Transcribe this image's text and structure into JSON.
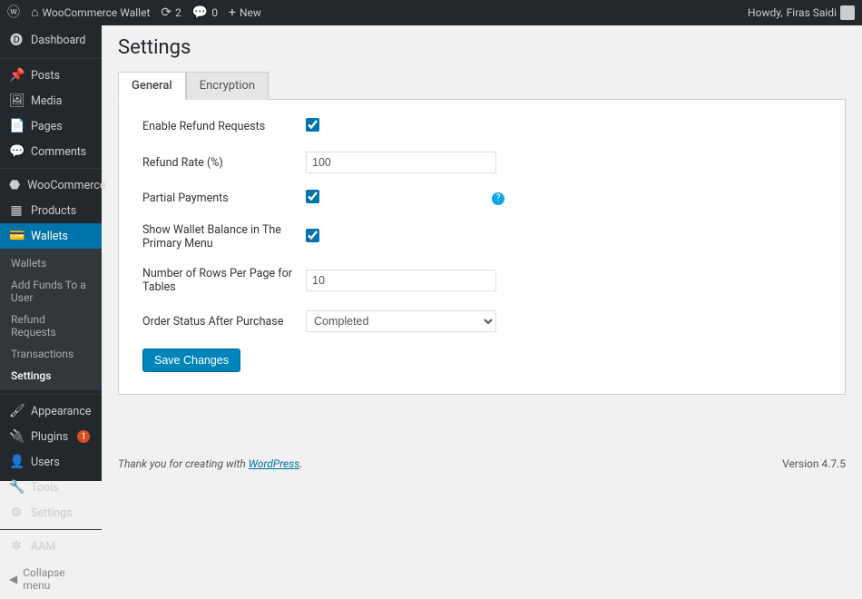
{
  "adminbar": {
    "site_name": "WooCommerce Wallet",
    "updates_count": "2",
    "comments_count": "0",
    "new_label": "New",
    "howdy_prefix": "Howdy,",
    "user_name": "Firas Saidi"
  },
  "sidebar": {
    "dashboard": "Dashboard",
    "posts": "Posts",
    "media": "Media",
    "pages": "Pages",
    "comments": "Comments",
    "woocommerce": "WooCommerce",
    "products": "Products",
    "wallets": "Wallets",
    "appearance": "Appearance",
    "plugins": "Plugins",
    "plugins_count": "1",
    "users": "Users",
    "tools": "Tools",
    "settings": "Settings",
    "aam": "AAM",
    "collapse": "Collapse menu",
    "submenu": {
      "wallets": "Wallets",
      "add_funds": "Add Funds To a User",
      "refund_requests": "Refund Requests",
      "transactions": "Transactions",
      "settings": "Settings"
    }
  },
  "page": {
    "title": "Settings",
    "tabs": {
      "general": "General",
      "encryption": "Encryption"
    },
    "fields": {
      "enable_refund": {
        "label": "Enable Refund Requests",
        "checked": true
      },
      "refund_rate": {
        "label": "Refund Rate (%)",
        "value": "100"
      },
      "partial_payments": {
        "label": "Partial Payments",
        "checked": true
      },
      "show_balance": {
        "label": "Show Wallet Balance in The Primary Menu",
        "checked": true
      },
      "rows_per_page": {
        "label": "Number of Rows Per Page for Tables",
        "value": "10"
      },
      "order_status": {
        "label": "Order Status After Purchase",
        "value": "Completed"
      }
    },
    "save_button": "Save Changes",
    "help_tooltip": "?"
  },
  "footer": {
    "thanks": "Thank you for creating with ",
    "wp_link": "WordPress",
    "period": ".",
    "version": "Version 4.7.5"
  }
}
